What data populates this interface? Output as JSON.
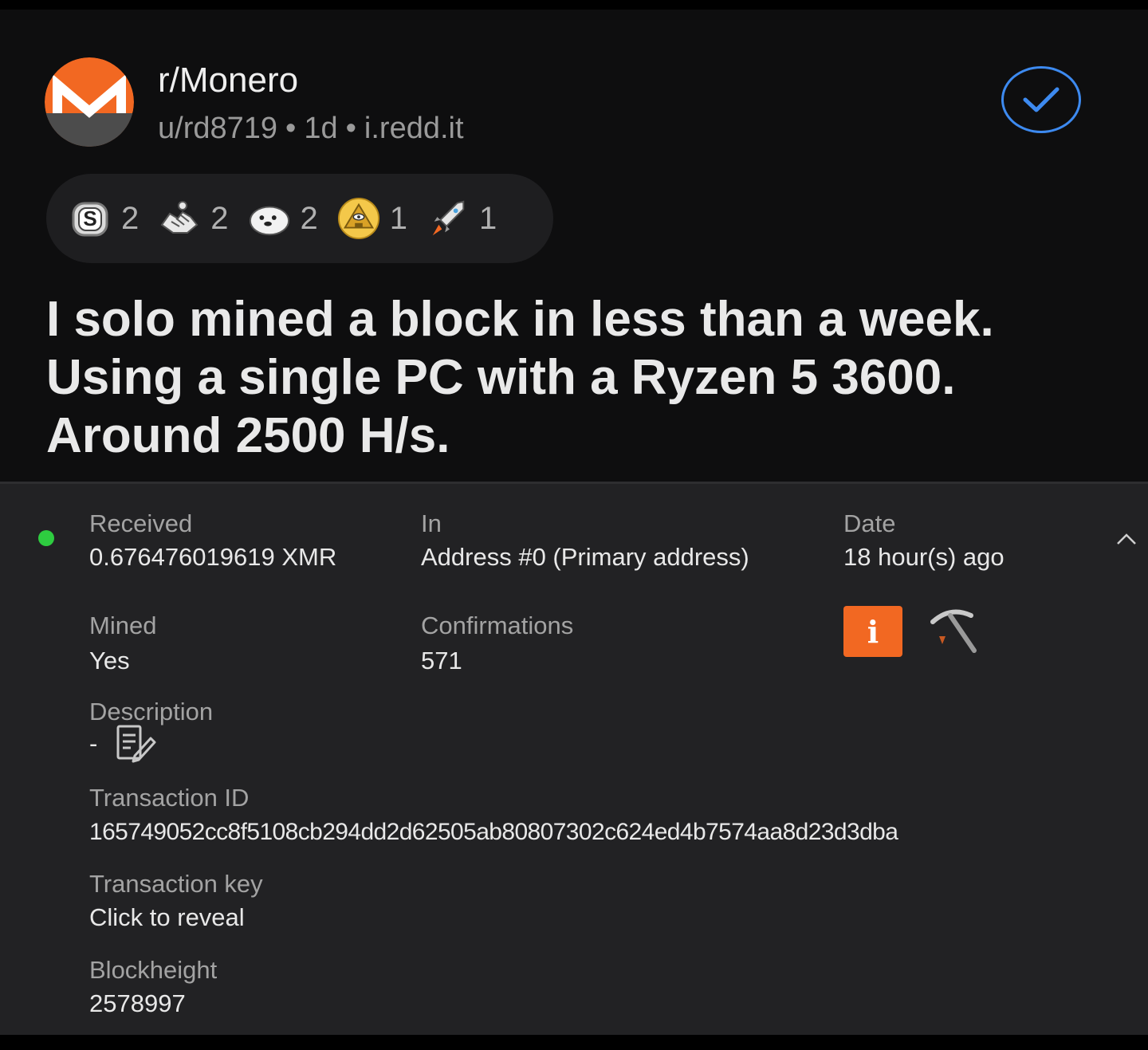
{
  "post": {
    "subreddit": "r/Monero",
    "author": "u/rd8719",
    "age": "1d",
    "domain": "i.redd.it",
    "separator": "•",
    "joined_icon": "check-circle-icon",
    "awards": [
      {
        "icon": "silver-award-icon",
        "count": "2"
      },
      {
        "icon": "handshake-award-icon",
        "count": "2"
      },
      {
        "icon": "seal-award-icon",
        "count": "2"
      },
      {
        "icon": "illuminati-award-icon",
        "count": "1"
      },
      {
        "icon": "rocket-award-icon",
        "count": "1"
      }
    ],
    "title": "I solo mined a block in less than a week. Using a single PC with a Ryzen 5 3600. Around 2500 H/s."
  },
  "tx": {
    "received_label": "Received",
    "received_value": "0.676476019619 XMR",
    "in_label": "In",
    "in_value": "Address #0 (Primary address)",
    "date_label": "Date",
    "date_value": "18 hour(s) ago",
    "mined_label": "Mined",
    "mined_value": "Yes",
    "confirmations_label": "Confirmations",
    "confirmations_value": "571",
    "description_label": "Description",
    "description_value": "-",
    "txid_label": "Transaction ID",
    "txid_value": "165749052cc8f5108cb294dd2d62505ab80807302c624ed4b7574aa8d23d3dba",
    "txkey_label": "Transaction key",
    "txkey_value": "Click to reveal",
    "blockheight_label": "Blockheight",
    "blockheight_value": "2578997",
    "info_glyph": "i"
  },
  "colors": {
    "monero_orange": "#f26822",
    "status_green": "#2ecc40",
    "check_blue": "#3d8af0",
    "panel_bg": "#222224"
  }
}
